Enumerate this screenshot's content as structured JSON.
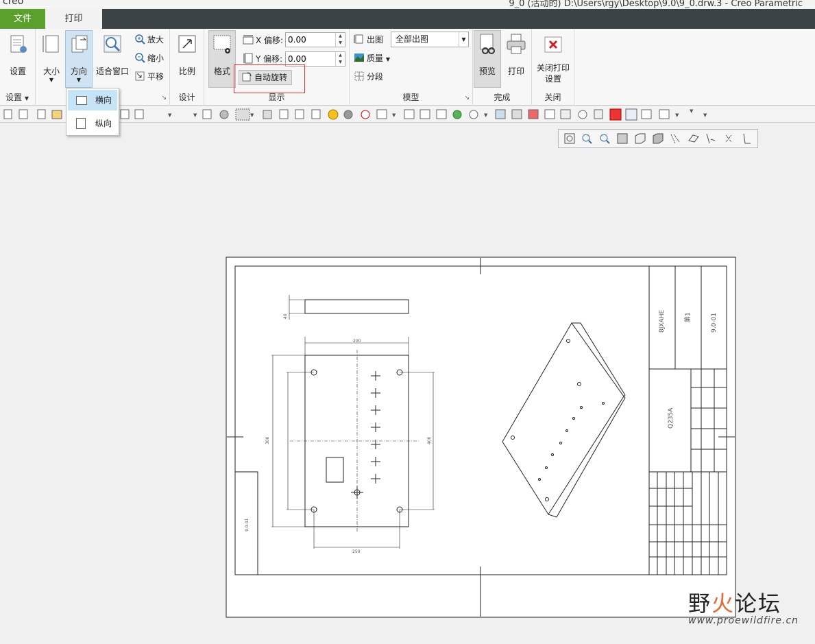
{
  "titlebar": {
    "app": "creo",
    "path": "9_0 (活动的) D:\\Users\\rgy\\Desktop\\9.0\\9_0.drw.3 - Creo Parametric"
  },
  "tabs": [
    {
      "label": "文件"
    },
    {
      "label": "打印"
    }
  ],
  "ribbon": {
    "setup": {
      "settings_label": "设置",
      "group_label": "设置"
    },
    "page": {
      "size_label": "大小",
      "orientation_label": "方向",
      "fit_label": "适合窗口",
      "zoom_in_label": "放大",
      "zoom_out_label": "缩小",
      "pan_label": "平移"
    },
    "design": {
      "scale_label": "比例",
      "group_label": "设计"
    },
    "display": {
      "format_label": "格式",
      "x_offset_label": "X 偏移:",
      "x_offset_value": "0.00",
      "y_offset_label": "Y 偏移:",
      "y_offset_value": "0.00",
      "auto_rotate_label": "自动旋转",
      "group_label": "显示"
    },
    "model": {
      "output_label": "出图",
      "output_value": "全部出图",
      "quality_label": "质量",
      "segment_label": "分段",
      "group_label": "模型"
    },
    "finish": {
      "preview_label": "预览",
      "print_label": "打印",
      "group_label": "完成"
    },
    "close": {
      "close_label": "关闭打印设置",
      "group_label": "关闭"
    }
  },
  "orientation_menu": [
    {
      "label": "横向",
      "selected": true
    },
    {
      "label": "纵向",
      "selected": false
    }
  ],
  "drawing": {
    "title_block": {
      "name": "8JXAHE",
      "material": "Q235A",
      "part_no": "9.0-01",
      "sheet": "第1"
    },
    "dims": {
      "top_width": "200",
      "bottom_width": "250",
      "height_left": "300",
      "height_right": "400",
      "thickness": "40"
    },
    "left_strip_text": "9.0-01"
  },
  "watermark": {
    "text_a": "野",
    "text_fire": "火",
    "text_b": "论坛",
    "url": "www.proewildfire.cn"
  },
  "colors": {
    "file_tab": "#5aa02c",
    "tabbar": "#3c4346",
    "highlight": "#e03030"
  }
}
